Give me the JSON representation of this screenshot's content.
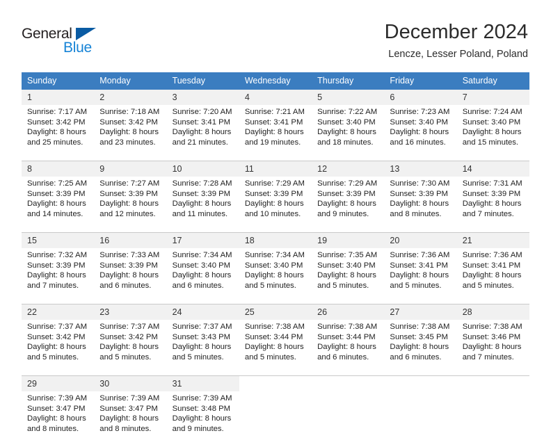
{
  "logo": {
    "word_one": "General",
    "word_two": "Blue",
    "triangle_icon": "triangle-icon",
    "color_dark": "#231f20",
    "color_blue": "#1683d6",
    "color_triangle": "#0a5ba3"
  },
  "header": {
    "title": "December 2024",
    "subtitle": "Lencze, Lesser Poland, Poland",
    "header_bg": "#3b7dc0",
    "daynum_bg": "#f1f1f1"
  },
  "weekdays": [
    "Sunday",
    "Monday",
    "Tuesday",
    "Wednesday",
    "Thursday",
    "Friday",
    "Saturday"
  ],
  "weeks": [
    [
      {
        "day": "1",
        "sunrise": "Sunrise: 7:17 AM",
        "sunset": "Sunset: 3:42 PM",
        "daylight_1": "Daylight: 8 hours",
        "daylight_2": "and 25 minutes."
      },
      {
        "day": "2",
        "sunrise": "Sunrise: 7:18 AM",
        "sunset": "Sunset: 3:42 PM",
        "daylight_1": "Daylight: 8 hours",
        "daylight_2": "and 23 minutes."
      },
      {
        "day": "3",
        "sunrise": "Sunrise: 7:20 AM",
        "sunset": "Sunset: 3:41 PM",
        "daylight_1": "Daylight: 8 hours",
        "daylight_2": "and 21 minutes."
      },
      {
        "day": "4",
        "sunrise": "Sunrise: 7:21 AM",
        "sunset": "Sunset: 3:41 PM",
        "daylight_1": "Daylight: 8 hours",
        "daylight_2": "and 19 minutes."
      },
      {
        "day": "5",
        "sunrise": "Sunrise: 7:22 AM",
        "sunset": "Sunset: 3:40 PM",
        "daylight_1": "Daylight: 8 hours",
        "daylight_2": "and 18 minutes."
      },
      {
        "day": "6",
        "sunrise": "Sunrise: 7:23 AM",
        "sunset": "Sunset: 3:40 PM",
        "daylight_1": "Daylight: 8 hours",
        "daylight_2": "and 16 minutes."
      },
      {
        "day": "7",
        "sunrise": "Sunrise: 7:24 AM",
        "sunset": "Sunset: 3:40 PM",
        "daylight_1": "Daylight: 8 hours",
        "daylight_2": "and 15 minutes."
      }
    ],
    [
      {
        "day": "8",
        "sunrise": "Sunrise: 7:25 AM",
        "sunset": "Sunset: 3:39 PM",
        "daylight_1": "Daylight: 8 hours",
        "daylight_2": "and 14 minutes."
      },
      {
        "day": "9",
        "sunrise": "Sunrise: 7:27 AM",
        "sunset": "Sunset: 3:39 PM",
        "daylight_1": "Daylight: 8 hours",
        "daylight_2": "and 12 minutes."
      },
      {
        "day": "10",
        "sunrise": "Sunrise: 7:28 AM",
        "sunset": "Sunset: 3:39 PM",
        "daylight_1": "Daylight: 8 hours",
        "daylight_2": "and 11 minutes."
      },
      {
        "day": "11",
        "sunrise": "Sunrise: 7:29 AM",
        "sunset": "Sunset: 3:39 PM",
        "daylight_1": "Daylight: 8 hours",
        "daylight_2": "and 10 minutes."
      },
      {
        "day": "12",
        "sunrise": "Sunrise: 7:29 AM",
        "sunset": "Sunset: 3:39 PM",
        "daylight_1": "Daylight: 8 hours",
        "daylight_2": "and 9 minutes."
      },
      {
        "day": "13",
        "sunrise": "Sunrise: 7:30 AM",
        "sunset": "Sunset: 3:39 PM",
        "daylight_1": "Daylight: 8 hours",
        "daylight_2": "and 8 minutes."
      },
      {
        "day": "14",
        "sunrise": "Sunrise: 7:31 AM",
        "sunset": "Sunset: 3:39 PM",
        "daylight_1": "Daylight: 8 hours",
        "daylight_2": "and 7 minutes."
      }
    ],
    [
      {
        "day": "15",
        "sunrise": "Sunrise: 7:32 AM",
        "sunset": "Sunset: 3:39 PM",
        "daylight_1": "Daylight: 8 hours",
        "daylight_2": "and 7 minutes."
      },
      {
        "day": "16",
        "sunrise": "Sunrise: 7:33 AM",
        "sunset": "Sunset: 3:39 PM",
        "daylight_1": "Daylight: 8 hours",
        "daylight_2": "and 6 minutes."
      },
      {
        "day": "17",
        "sunrise": "Sunrise: 7:34 AM",
        "sunset": "Sunset: 3:40 PM",
        "daylight_1": "Daylight: 8 hours",
        "daylight_2": "and 6 minutes."
      },
      {
        "day": "18",
        "sunrise": "Sunrise: 7:34 AM",
        "sunset": "Sunset: 3:40 PM",
        "daylight_1": "Daylight: 8 hours",
        "daylight_2": "and 5 minutes."
      },
      {
        "day": "19",
        "sunrise": "Sunrise: 7:35 AM",
        "sunset": "Sunset: 3:40 PM",
        "daylight_1": "Daylight: 8 hours",
        "daylight_2": "and 5 minutes."
      },
      {
        "day": "20",
        "sunrise": "Sunrise: 7:36 AM",
        "sunset": "Sunset: 3:41 PM",
        "daylight_1": "Daylight: 8 hours",
        "daylight_2": "and 5 minutes."
      },
      {
        "day": "21",
        "sunrise": "Sunrise: 7:36 AM",
        "sunset": "Sunset: 3:41 PM",
        "daylight_1": "Daylight: 8 hours",
        "daylight_2": "and 5 minutes."
      }
    ],
    [
      {
        "day": "22",
        "sunrise": "Sunrise: 7:37 AM",
        "sunset": "Sunset: 3:42 PM",
        "daylight_1": "Daylight: 8 hours",
        "daylight_2": "and 5 minutes."
      },
      {
        "day": "23",
        "sunrise": "Sunrise: 7:37 AM",
        "sunset": "Sunset: 3:42 PM",
        "daylight_1": "Daylight: 8 hours",
        "daylight_2": "and 5 minutes."
      },
      {
        "day": "24",
        "sunrise": "Sunrise: 7:37 AM",
        "sunset": "Sunset: 3:43 PM",
        "daylight_1": "Daylight: 8 hours",
        "daylight_2": "and 5 minutes."
      },
      {
        "day": "25",
        "sunrise": "Sunrise: 7:38 AM",
        "sunset": "Sunset: 3:44 PM",
        "daylight_1": "Daylight: 8 hours",
        "daylight_2": "and 5 minutes."
      },
      {
        "day": "26",
        "sunrise": "Sunrise: 7:38 AM",
        "sunset": "Sunset: 3:44 PM",
        "daylight_1": "Daylight: 8 hours",
        "daylight_2": "and 6 minutes."
      },
      {
        "day": "27",
        "sunrise": "Sunrise: 7:38 AM",
        "sunset": "Sunset: 3:45 PM",
        "daylight_1": "Daylight: 8 hours",
        "daylight_2": "and 6 minutes."
      },
      {
        "day": "28",
        "sunrise": "Sunrise: 7:38 AM",
        "sunset": "Sunset: 3:46 PM",
        "daylight_1": "Daylight: 8 hours",
        "daylight_2": "and 7 minutes."
      }
    ],
    [
      {
        "day": "29",
        "sunrise": "Sunrise: 7:39 AM",
        "sunset": "Sunset: 3:47 PM",
        "daylight_1": "Daylight: 8 hours",
        "daylight_2": "and 8 minutes."
      },
      {
        "day": "30",
        "sunrise": "Sunrise: 7:39 AM",
        "sunset": "Sunset: 3:47 PM",
        "daylight_1": "Daylight: 8 hours",
        "daylight_2": "and 8 minutes."
      },
      {
        "day": "31",
        "sunrise": "Sunrise: 7:39 AM",
        "sunset": "Sunset: 3:48 PM",
        "daylight_1": "Daylight: 8 hours",
        "daylight_2": "and 9 minutes."
      },
      {
        "day": "",
        "sunrise": "",
        "sunset": "",
        "daylight_1": "",
        "daylight_2": ""
      },
      {
        "day": "",
        "sunrise": "",
        "sunset": "",
        "daylight_1": "",
        "daylight_2": ""
      },
      {
        "day": "",
        "sunrise": "",
        "sunset": "",
        "daylight_1": "",
        "daylight_2": ""
      },
      {
        "day": "",
        "sunrise": "",
        "sunset": "",
        "daylight_1": "",
        "daylight_2": ""
      }
    ]
  ]
}
